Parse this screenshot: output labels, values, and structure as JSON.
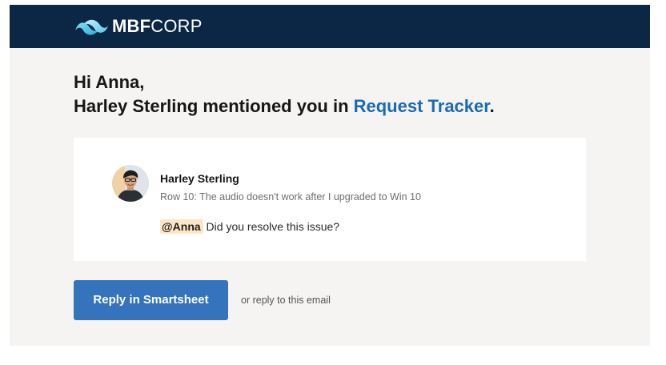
{
  "brand": {
    "logo_bold": "MBF",
    "logo_light": "CORP",
    "logo_icon": "wave-logo-icon",
    "header_color": "#0b2745"
  },
  "greeting": {
    "line1": "Hi Anna,",
    "line2_prefix": "Harley Sterling mentioned you in ",
    "sheet_link": "Request Tracker",
    "line2_suffix": "."
  },
  "comment": {
    "author": "Harley Sterling",
    "row": "Row 10: The audio doesn't work after I upgraded to Win 10",
    "mention": "@Anna",
    "text": " Did you resolve this issue?",
    "avatar_icon": "user-avatar"
  },
  "actions": {
    "reply_button": "Reply in Smartsheet",
    "reply_email": "or reply to this email"
  },
  "colors": {
    "accent": "#3673bd",
    "link": "#1a6bb5",
    "mention_bg": "#fce6c8",
    "page_bg": "#f5f4f2"
  }
}
